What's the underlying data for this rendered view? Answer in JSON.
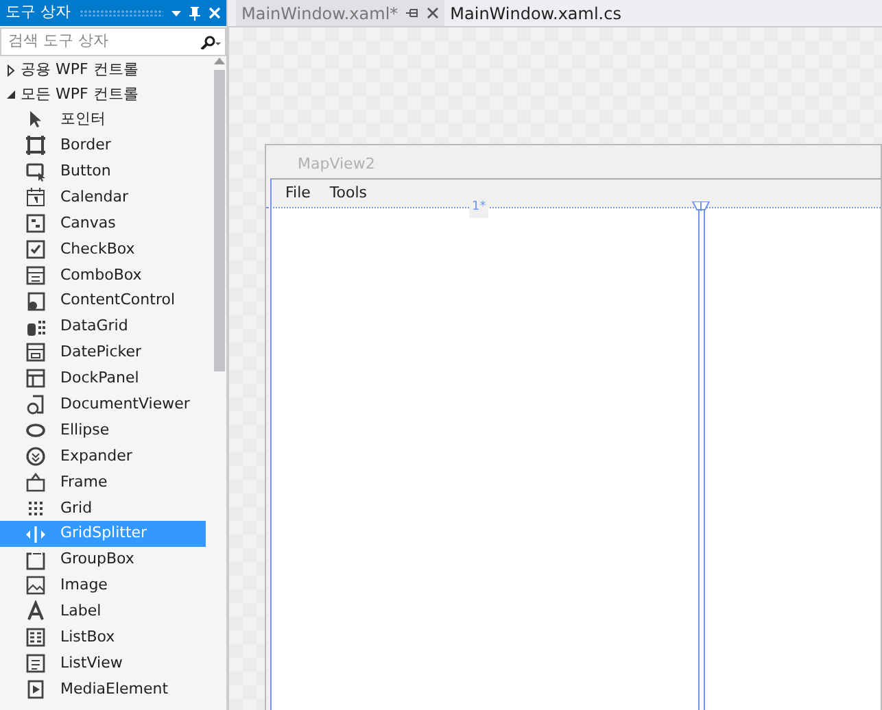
{
  "toolbox": {
    "title": "도구 상자",
    "search": {
      "placeholder": "검색 도구 상자"
    },
    "groups": [
      {
        "label": "공용 WPF 컨트롤",
        "expanded": false
      },
      {
        "label": "모든 WPF 컨트롤",
        "expanded": true,
        "children": [
          {
            "label": "포인터",
            "selected": false
          },
          {
            "label": "Border",
            "selected": false
          },
          {
            "label": "Button",
            "selected": false
          },
          {
            "label": "Calendar",
            "selected": false
          },
          {
            "label": "Canvas",
            "selected": false
          },
          {
            "label": "CheckBox",
            "selected": false
          },
          {
            "label": "ComboBox",
            "selected": false
          },
          {
            "label": "ContentControl",
            "selected": false
          },
          {
            "label": "DataGrid",
            "selected": false
          },
          {
            "label": "DatePicker",
            "selected": false
          },
          {
            "label": "DockPanel",
            "selected": false
          },
          {
            "label": "DocumentViewer",
            "selected": false
          },
          {
            "label": "Ellipse",
            "selected": false
          },
          {
            "label": "Expander",
            "selected": false
          },
          {
            "label": "Frame",
            "selected": false
          },
          {
            "label": "Grid",
            "selected": false
          },
          {
            "label": "GridSplitter",
            "selected": true
          },
          {
            "label": "GroupBox",
            "selected": false
          },
          {
            "label": "Image",
            "selected": false
          },
          {
            "label": "Label",
            "selected": false
          },
          {
            "label": "ListBox",
            "selected": false
          },
          {
            "label": "ListView",
            "selected": false
          },
          {
            "label": "MediaElement",
            "selected": false
          }
        ]
      }
    ]
  },
  "tabs": [
    {
      "label": "MainWindow.xaml*",
      "selected": false,
      "closable": true
    },
    {
      "label": "MainWindow.xaml.cs",
      "selected": true,
      "closable": false
    }
  ],
  "designer": {
    "window_title": "MapView2",
    "menu": [
      "File",
      "Tools"
    ],
    "column_width": "1*"
  }
}
